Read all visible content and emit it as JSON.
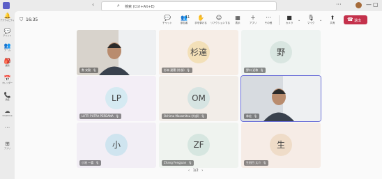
{
  "titlebar": {
    "search_placeholder": "検索 (Ctrl+Alt+E)",
    "more": "···",
    "window_min": "—",
    "window_max": "▢",
    "window_close": "✕"
  },
  "rail": [
    {
      "label": "アクティビティ",
      "icon": "bell-icon",
      "glyph": "🔔"
    },
    {
      "label": "チャット",
      "icon": "chat-icon",
      "glyph": "💬"
    },
    {
      "label": "チーム",
      "icon": "teams-icon",
      "glyph": "👥"
    },
    {
      "label": "課題",
      "icon": "assignments-icon",
      "glyph": "🎒"
    },
    {
      "label": "カレンダー",
      "icon": "calendar-icon",
      "glyph": "📅"
    },
    {
      "label": "通話",
      "icon": "phone-icon",
      "glyph": "📞"
    },
    {
      "label": "OneDrive",
      "icon": "cloud-icon",
      "glyph": "☁"
    },
    {
      "label": "",
      "icon": "more-icon",
      "glyph": "···"
    },
    {
      "label": "アプリ",
      "icon": "apps-icon",
      "glyph": "⊞"
    }
  ],
  "meeting": {
    "time": "16:35",
    "toolbar": [
      {
        "label": "チャット",
        "icon": "chat-icon",
        "glyph": "💬"
      },
      {
        "label": "参加者",
        "icon": "people-icon",
        "glyph": "👥",
        "count": "11"
      },
      {
        "label": "手を挙げる",
        "icon": "raise-hand-icon",
        "glyph": "✋"
      },
      {
        "label": "リアクションする",
        "icon": "reaction-icon",
        "glyph": "☺"
      },
      {
        "label": "表示",
        "icon": "view-icon",
        "glyph": "▦"
      },
      {
        "label": "アプリ",
        "icon": "apps-icon",
        "glyph": "＋"
      },
      {
        "label": "その他",
        "icon": "more-icon",
        "glyph": "···"
      },
      {
        "label": "カメラ",
        "icon": "camera-icon",
        "glyph": "■"
      },
      {
        "label": "マイク",
        "icon": "mic-off-icon",
        "glyph": "🎙"
      },
      {
        "label": "共有",
        "icon": "share-icon",
        "glyph": "⬆"
      }
    ],
    "leave_label": "退出",
    "leave_glyph": "☎"
  },
  "participants": [
    {
      "name": "数 安勤",
      "type": "video",
      "bg": "#d8d3cc"
    },
    {
      "name": "杉本 達穂 (外部)",
      "type": "initials",
      "initials": "杉達",
      "circle": "#f3e0b8",
      "bg": "#f6ede6"
    },
    {
      "name": "野口 近和",
      "type": "initials",
      "initials": "野",
      "circle": "#d9e6e1",
      "bg": "#eef3f1"
    },
    {
      "name": "LUTFI PUTRA PERDANA",
      "type": "initials",
      "initials": "LP",
      "circle": "#d5eaf2",
      "bg": "#f3eef6"
    },
    {
      "name": "Oshima Masamitsu (外部)",
      "type": "initials",
      "initials": "OM",
      "circle": "#d6e4e2",
      "bg": "#f2ede8"
    },
    {
      "name": "林宏",
      "type": "video",
      "bg": "#d7dbe0",
      "selected": true
    },
    {
      "name": "小池 一喜",
      "type": "initials",
      "initials": "小",
      "circle": "#cfe4ef",
      "bg": "#f2eef5"
    },
    {
      "name": "Zhang Fengjuan",
      "type": "initials",
      "initials": "ZF",
      "circle": "#d6e6e0",
      "bg": "#eff3ef"
    },
    {
      "name": "生田目 太介",
      "type": "initials",
      "initials": "生",
      "circle": "#efdcc8",
      "bg": "#f6ece6"
    }
  ],
  "pagination": {
    "text": "1/2",
    "prev": "‹",
    "next": "›"
  }
}
